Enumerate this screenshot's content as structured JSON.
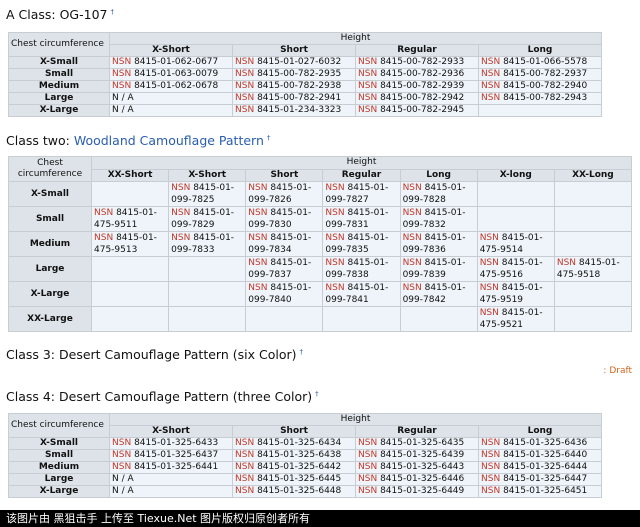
{
  "section1": {
    "title": "A Class: OG-107",
    "corner": "Chest circumference",
    "height_label": "Height",
    "cols": [
      "X-Short",
      "Short",
      "Regular",
      "Long"
    ],
    "rows": [
      {
        "size": "X-Small",
        "cells": [
          "8415-01-062-0677",
          "8415-01-027-6032",
          "8415-00-782-2933",
          "8415-01-066-5578"
        ]
      },
      {
        "size": "Small",
        "cells": [
          "8415-01-063-0079",
          "8415-00-782-2935",
          "8415-00-782-2936",
          "8415-00-782-2937"
        ]
      },
      {
        "size": "Medium",
        "cells": [
          "8415-01-062-0678",
          "8415-00-782-2938",
          "8415-00-782-2939",
          "8415-00-782-2940"
        ]
      },
      {
        "size": "Large",
        "cells": [
          "N / A",
          "8415-00-782-2941",
          "8415-00-782-2942",
          "8415-00-782-2943"
        ]
      },
      {
        "size": "X-Large",
        "cells": [
          "N / A",
          "8415-01-234-3323",
          "8415-00-782-2945",
          ""
        ]
      }
    ]
  },
  "section2": {
    "title_prefix": "Class two: ",
    "title_link": "Woodland Camouflage Pattern",
    "corner": "Chest circumference",
    "height_label": "Height",
    "cols": [
      "XX-Short",
      "X-Short",
      "Short",
      "Regular",
      "Long",
      "X-long",
      "XX-Long"
    ],
    "rows": [
      {
        "size": "X-Small",
        "cells": [
          "",
          "8415-01-099-7825",
          "8415-01-099-7826",
          "8415-01-099-7827",
          "8415-01-099-7828",
          "",
          ""
        ]
      },
      {
        "size": "Small",
        "cells": [
          "8415-01-475-9511",
          "8415-01-099-7829",
          "8415-01-099-7830",
          "8415-01-099-7831",
          "8415-01-099-7832",
          "",
          ""
        ]
      },
      {
        "size": "Medium",
        "cells": [
          "8415-01-475-9513",
          "8415-01-099-7833",
          "8415-01-099-7834",
          "8415-01-099-7835",
          "8415-01-099-7836",
          "8415-01-475-9514",
          ""
        ]
      },
      {
        "size": "Large",
        "cells": [
          "",
          "",
          "8415-01-099-7837",
          "8415-01-099-7838",
          "8415-01-099-7839",
          "8415-01-475-9516",
          "8415-01-475-9518"
        ]
      },
      {
        "size": "X-Large",
        "cells": [
          "",
          "",
          "8415-01-099-7840",
          "8415-01-099-7841",
          "8415-01-099-7842",
          "8415-01-475-9519",
          ""
        ]
      },
      {
        "size": "XX-Large",
        "cells": [
          "",
          "",
          "",
          "",
          "",
          "8415-01-475-9521",
          ""
        ]
      }
    ]
  },
  "section3": {
    "title": "Class 3: Desert Camouflage Pattern (six Color)",
    "draft": ": Draft"
  },
  "section4": {
    "title": "Class 4: Desert Camouflage Pattern (three Color)",
    "corner": "Chest circumference",
    "height_label": "Height",
    "cols": [
      "X-Short",
      "Short",
      "Regular",
      "Long"
    ],
    "rows": [
      {
        "size": "X-Small",
        "cells": [
          "8415-01-325-6433",
          "8415-01-325-6434",
          "8415-01-325-6435",
          "8415-01-325-6436"
        ]
      },
      {
        "size": "Small",
        "cells": [
          "8415-01-325-6437",
          "8415-01-325-6438",
          "8415-01-325-6439",
          "8415-01-325-6440"
        ]
      },
      {
        "size": "Medium",
        "cells": [
          "8415-01-325-6441",
          "8415-01-325-6442",
          "8415-01-325-6443",
          "8415-01-325-6444"
        ]
      },
      {
        "size": "Large",
        "cells": [
          "N / A",
          "8415-01-325-6445",
          "8415-01-325-6446",
          "8415-01-325-6447"
        ]
      },
      {
        "size": "X-Large",
        "cells": [
          "N / A",
          "8415-01-325-6448",
          "8415-01-325-6449",
          "8415-01-325-6451"
        ]
      }
    ]
  },
  "nsn_prefix": "NSN",
  "sup_mark": "†",
  "footer": "该图片由 黑狙击手 上传至 Tiexue.Net 图片版权归原创者所有"
}
